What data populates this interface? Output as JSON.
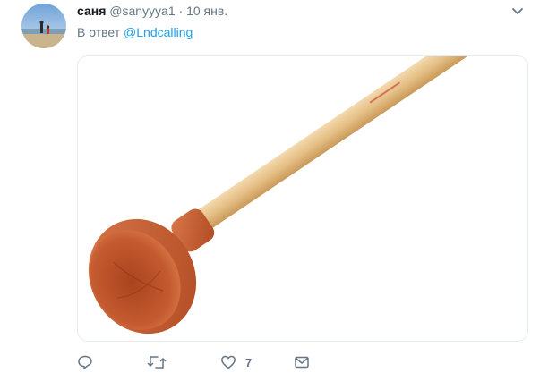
{
  "tweet": {
    "author_name": "саня",
    "author_handle": "@sanyyya1",
    "separator": "·",
    "date": "10 янв.",
    "reply_prefix": "В ответ",
    "reply_to": "@Lndcalling",
    "media_subject": "plunger-image"
  },
  "actions": {
    "reply_count": "",
    "retweet_count": "",
    "like_count": "7",
    "message_count": ""
  },
  "colors": {
    "link": "#1da1f2",
    "muted": "#657786",
    "plunger_rubber": "#c85a2e",
    "handle_wood": "#e8c48c"
  },
  "icons": [
    "chevron-down-icon",
    "reply-icon",
    "retweet-icon",
    "like-icon",
    "message-icon"
  ]
}
